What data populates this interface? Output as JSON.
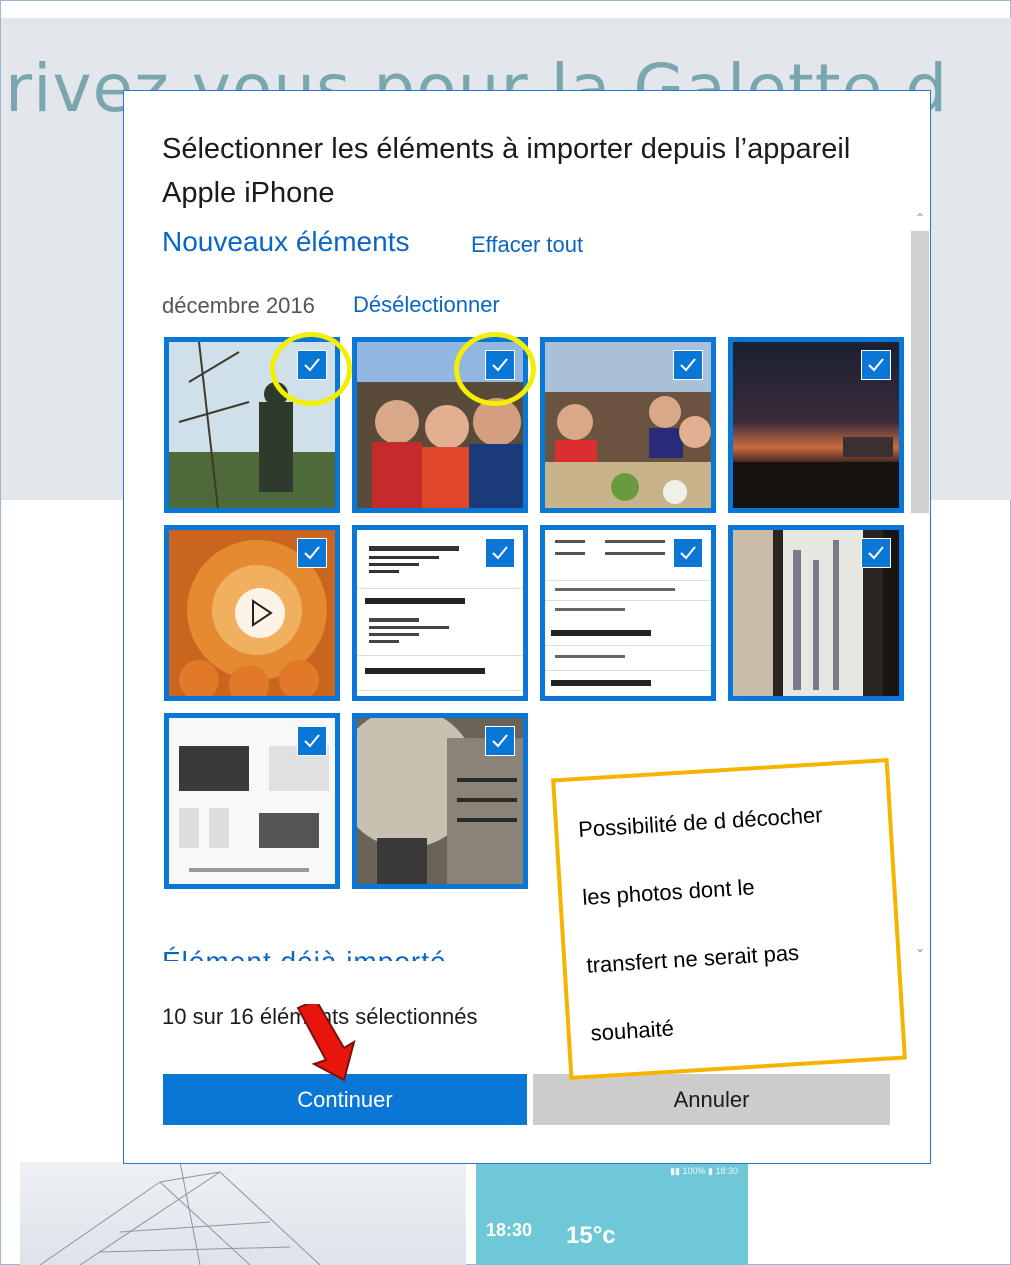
{
  "background": {
    "banner_text": "rivez vous pour la Galette d",
    "phone_time": "18:30",
    "phone_temp": "15°c"
  },
  "dialog": {
    "title": "Sélectionner les éléments à importer depuis l’appareil Apple iPhone",
    "section_title": "Nouveaux éléments",
    "clear_all": "Effacer tout",
    "month_label": "décembre 2016",
    "deselect": "Désélectionner",
    "next_group": "Élément déjà importé",
    "count_label": "10 sur 16 éléments sélectionnés",
    "continue_label": "Continuer",
    "cancel_label": "Annuler"
  },
  "thumbnails": [
    {
      "name": "photo-statue",
      "checked": true,
      "video": false
    },
    {
      "name": "photo-selfie-group",
      "checked": true,
      "video": false
    },
    {
      "name": "photo-terrace-lunch",
      "checked": true,
      "video": false
    },
    {
      "name": "photo-sunset",
      "checked": true,
      "video": false
    },
    {
      "name": "video-galettes",
      "checked": true,
      "video": true
    },
    {
      "name": "screenshot-order-address",
      "checked": true,
      "video": false
    },
    {
      "name": "screenshot-order-details",
      "checked": true,
      "video": false
    },
    {
      "name": "photo-meter-panel",
      "checked": true,
      "video": false
    },
    {
      "name": "screenshot-hdmi-cable",
      "checked": true,
      "video": false
    },
    {
      "name": "photo-meter-closeup",
      "checked": true,
      "video": false
    }
  ],
  "annotation": {
    "note_lines": [
      "Possibilité de d décocher",
      "les photos dont le",
      "transfert ne serait pas",
      "souhaité"
    ],
    "circle_color": "#f4ef00",
    "box_color": "#f5b400",
    "arrow_color": "#e8150c"
  },
  "colors": {
    "accent": "#0a76d6",
    "link": "#0a66c2",
    "cancel_bg": "#cccccc"
  }
}
